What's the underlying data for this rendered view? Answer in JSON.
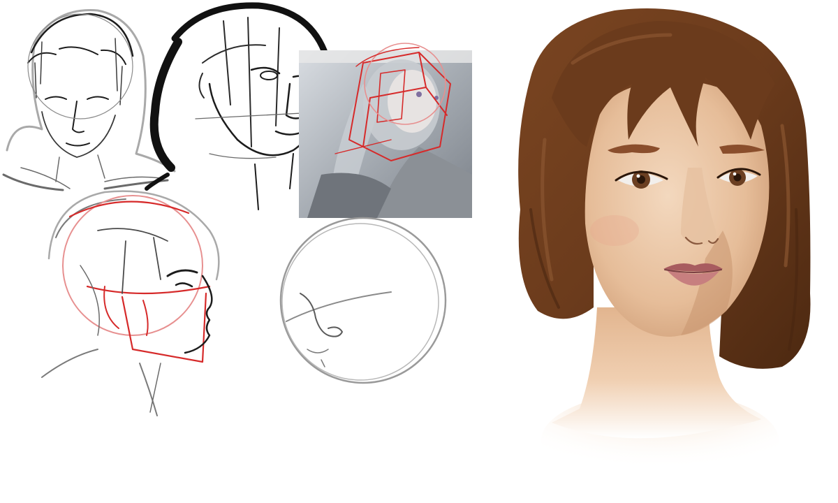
{
  "canvas": {
    "background": "#ffffff"
  },
  "palette": {
    "sketch_dark": "#1c1c1c",
    "sketch_mid": "#6a6a6a",
    "sketch_light": "#a9a9a9",
    "construction_red": "#d62a2a",
    "construction_pink": "#e79090",
    "hair_brown": "#6b3b1c",
    "hair_highlight": "#8a5530",
    "hair_shadow": "#4a2710",
    "skin_light": "#f1d4b8",
    "skin_mid": "#e3b894",
    "skin_shadow": "#c9966f",
    "lip": "#b86a6a",
    "eye_iris": "#6b3f22",
    "photo_tone": "#9ca2a9"
  }
}
